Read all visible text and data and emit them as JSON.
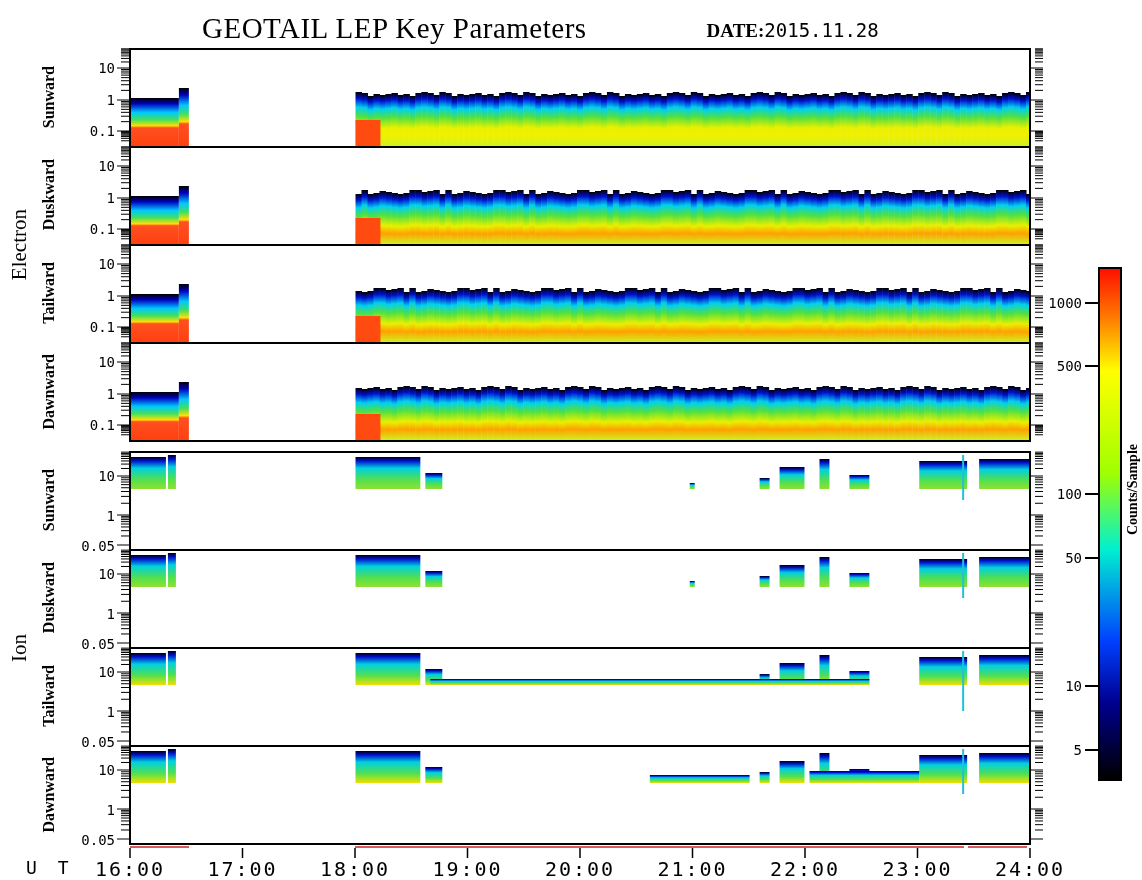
{
  "title": "GEOTAIL LEP Key Parameters",
  "date": "**DATE:**2015.11.28",
  "groups": [
    {
      "label": "Electron",
      "kind": "electron",
      "panels": [
        {
          "label": "Sunward",
          "yticks": [
            "10",
            "1",
            "0.1"
          ]
        },
        {
          "label": "Duskward",
          "yticks": [
            "10",
            "1",
            "0.1"
          ]
        },
        {
          "label": "Tailward",
          "yticks": [
            "10",
            "1",
            "0.1"
          ]
        },
        {
          "label": "Dawnward",
          "yticks": [
            "10",
            "1",
            "0.1"
          ]
        }
      ]
    },
    {
      "label": "Ion",
      "kind": "ion",
      "panels": [
        {
          "label": "Sunward",
          "yticks": [
            "10",
            "1",
            "0.05"
          ]
        },
        {
          "label": "Duskward",
          "yticks": [
            "10",
            "1",
            "0.05"
          ]
        },
        {
          "label": "Tailward",
          "yticks": [
            "10",
            "1",
            "0.05"
          ]
        },
        {
          "label": "Dawnward",
          "yticks": [
            "10",
            "1",
            "0.05"
          ]
        }
      ]
    }
  ],
  "time_axis": {
    "label": "U T",
    "ticks": [
      "16:00",
      "17:00",
      "18:00",
      "19:00",
      "20:00",
      "21:00",
      "22:00",
      "23:00",
      "24:00"
    ]
  },
  "colorbar": {
    "title": "Counts/Sample",
    "ticks": [
      "1000",
      "500",
      "100",
      "50",
      "10",
      "5"
    ]
  }
}
